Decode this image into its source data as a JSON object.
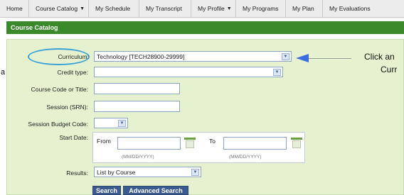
{
  "nav": {
    "tabs": [
      {
        "label": "Home",
        "dropdown": false
      },
      {
        "label": "Course Catalog",
        "dropdown": true
      },
      {
        "label": "My Schedule",
        "dropdown": false
      },
      {
        "label": "My Transcript",
        "dropdown": false
      },
      {
        "label": "My Profile",
        "dropdown": true
      },
      {
        "label": "My Programs",
        "dropdown": false
      },
      {
        "label": "My Plan",
        "dropdown": false
      },
      {
        "label": "My Evaluations",
        "dropdown": false
      }
    ],
    "caret": "▼"
  },
  "header": {
    "title": "Course Catalog"
  },
  "form": {
    "curriculum": {
      "label": "Curriculum:",
      "value": "Technology [TECH28900-29999]"
    },
    "credit_type": {
      "label": "Credit type:",
      "value": ""
    },
    "course_code": {
      "label": "Course Code or Title:",
      "value": ""
    },
    "session": {
      "label": "Session (SRN):",
      "value": ""
    },
    "budget_code": {
      "label": "Session Budget Code:",
      "value": ""
    },
    "start_date": {
      "label": "Start Date:",
      "from_label": "From",
      "to_label": "To",
      "from_hint": "(MM/DD/YYYY)",
      "to_hint": "(MM/DD/YYYY)"
    },
    "results": {
      "label": "Results:",
      "value": "List by Course"
    }
  },
  "buttons": {
    "search": "Search",
    "advanced": "Advanced Search"
  },
  "annotation": {
    "line1": "Click an",
    "line2": "Curr",
    "side_char": "a"
  },
  "colors": {
    "header": "#3a8a2c",
    "panel": "#e6f1d0",
    "highlight": "#3aa2d8",
    "arrow": "#3b6fe0"
  }
}
